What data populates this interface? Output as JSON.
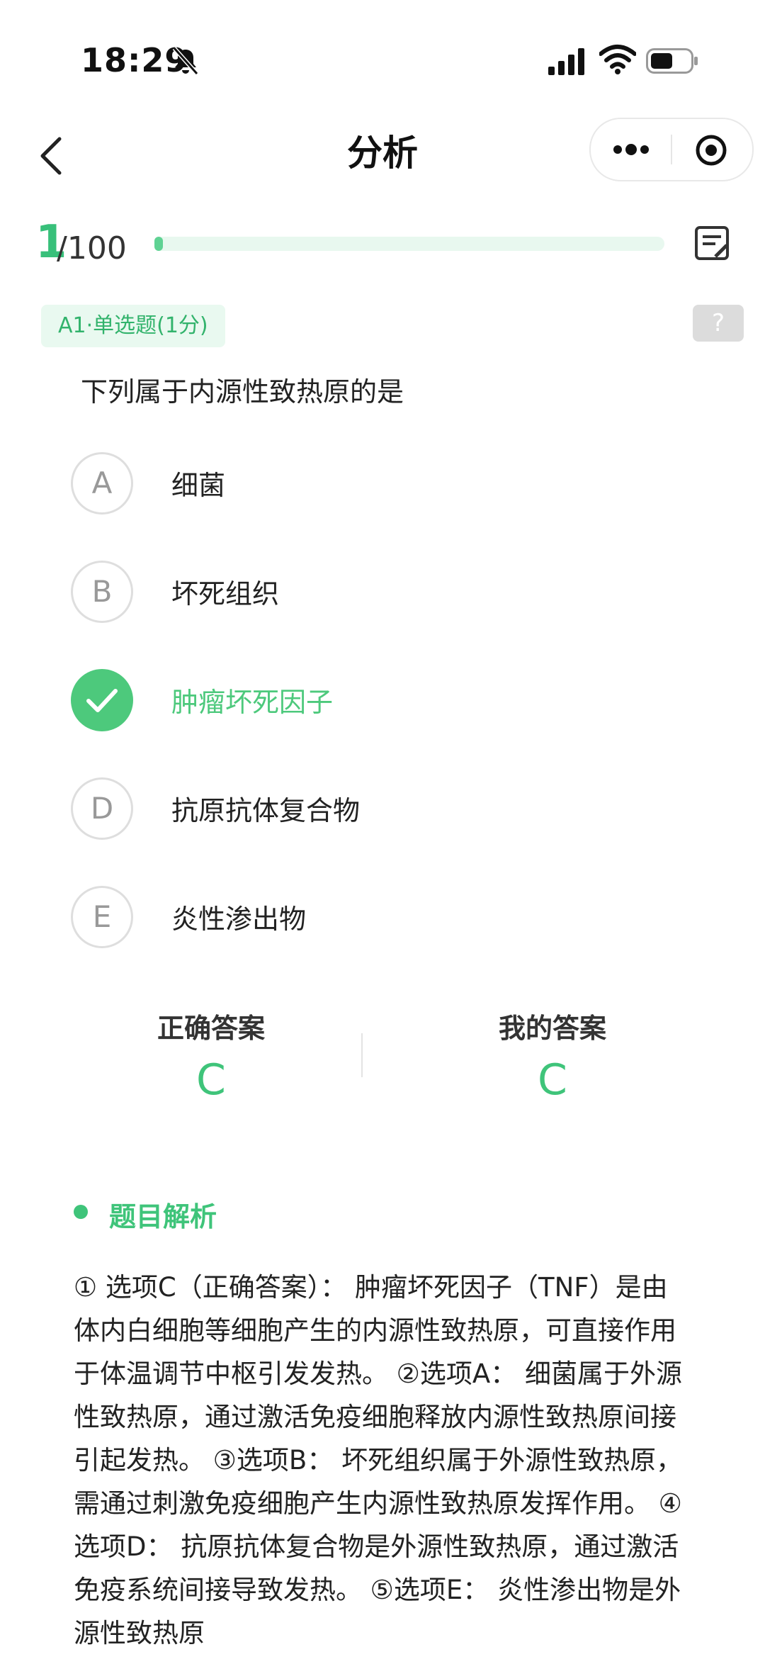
{
  "status_bar": {
    "time": "18:29"
  },
  "nav": {
    "title": "分析"
  },
  "progress": {
    "current": "1",
    "total": "/100",
    "fraction": 0.01
  },
  "question": {
    "type": "A1·单选题(1分)",
    "help": "?",
    "stem": "下列属于内源性致热原的是",
    "options": [
      {
        "letter": "A",
        "text": "细菌",
        "correct": false
      },
      {
        "letter": "B",
        "text": "坏死组织",
        "correct": false
      },
      {
        "letter": "C",
        "text": "肿瘤坏死因子",
        "correct": true
      },
      {
        "letter": "D",
        "text": "抗原抗体复合物",
        "correct": false
      },
      {
        "letter": "E",
        "text": "炎性渗出物",
        "correct": false
      }
    ]
  },
  "answers": {
    "correct_label": "正确答案",
    "correct_value": "C",
    "mine_label": "我的答案",
    "mine_value": "C"
  },
  "analysis": {
    "heading": "题目解析",
    "text": "① 选项C（正确答案）： 肿瘤坏死因子（TNF）是由体内白细胞等细胞产生的内源性致热原，可直接作用于体温调节中枢引发发热。 ②选项A： 细菌属于外源性致热原，通过激活免疫细胞释放内源性致热原间接引起发热。 ③选项B： 坏死组织属于外源性致热原，需通过刺激免疫细胞产生内源性致热原发挥作用。 ④选项D： 抗原抗体复合物是外源性致热原，通过激活免疫系统间接导致发热。 ⑤选项E： 炎性渗出物是外源性致热原"
  },
  "colors": {
    "accent": "#3fc47a",
    "accent_light": "#e9f9f0",
    "text": "#222222"
  }
}
